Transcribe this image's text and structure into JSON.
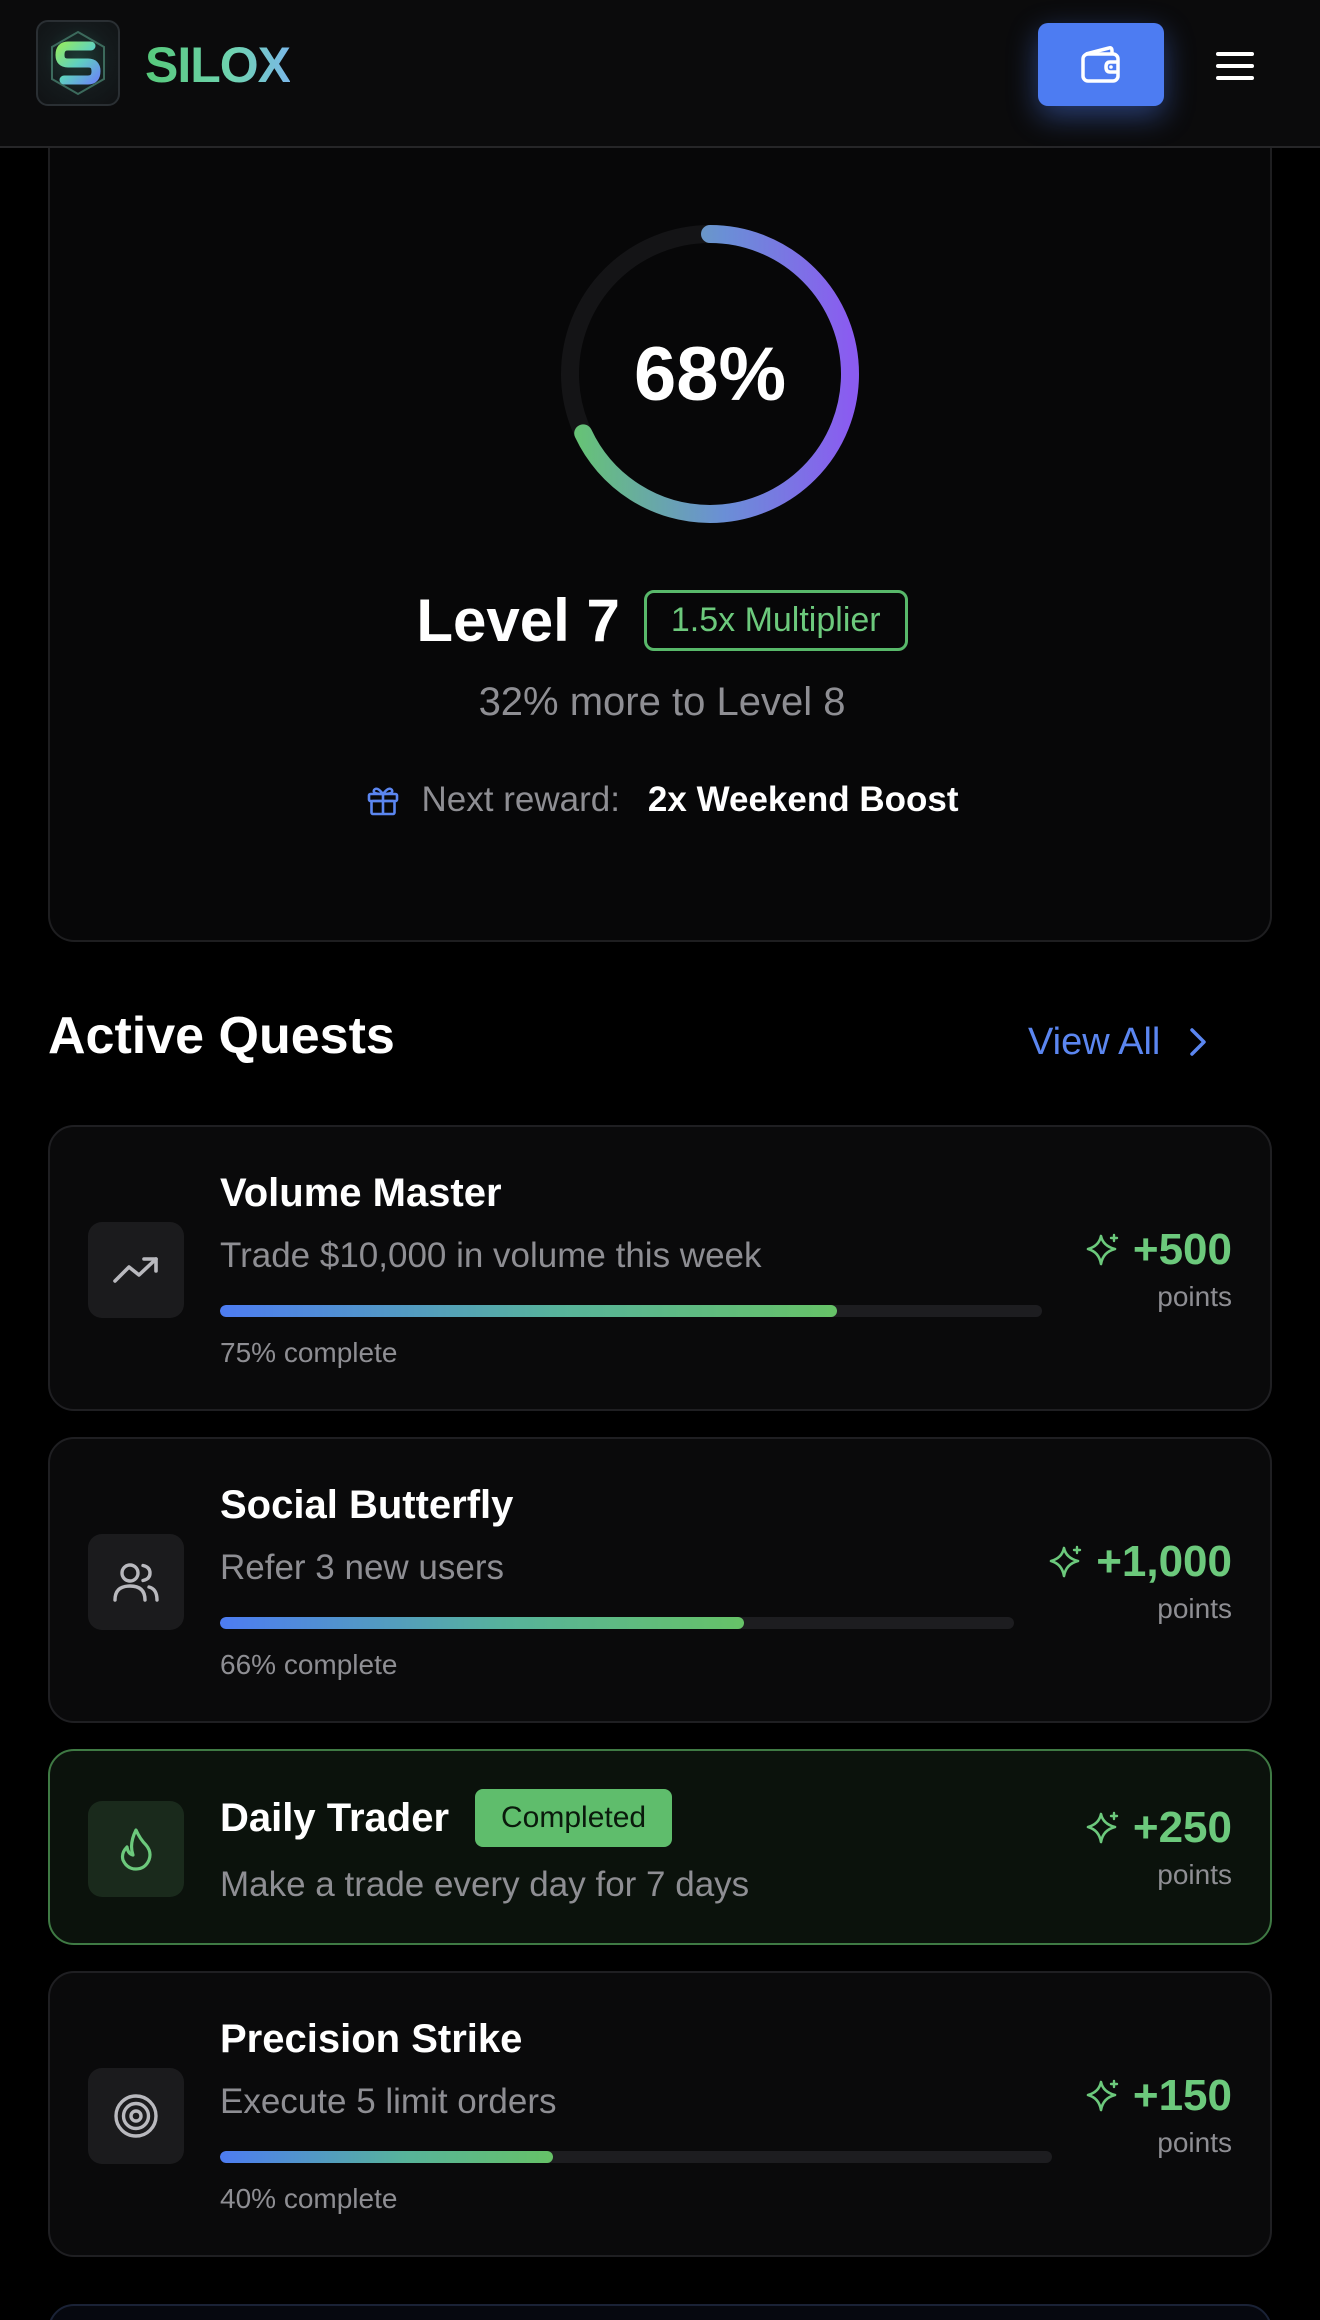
{
  "header": {
    "brand": "SILOX",
    "logo_icon": "silox-s-logo",
    "wallet_icon": "wallet-icon",
    "menu_icon": "hamburger-menu-icon"
  },
  "level_card": {
    "progress_percent_label": "68%",
    "progress_fraction": 0.68,
    "level_label": "Level 7",
    "multiplier_label": "1.5x Multiplier",
    "more_to_next": "32% more to Level 8",
    "next_reward_label": "Next reward:",
    "next_reward_value": "2x Weekend Boost",
    "reward_icon": "gift-icon"
  },
  "quests_section": {
    "title": "Active Quests",
    "view_all_label": "View All"
  },
  "quests": [
    {
      "title": "Volume Master",
      "description": "Trade $10,000 in volume this week",
      "progress": 0.75,
      "progress_label": "75% complete",
      "points": "+500",
      "points_unit": "points",
      "icon": "trending-up-icon",
      "completed": false
    },
    {
      "title": "Social Butterfly",
      "description": "Refer 3 new users",
      "progress": 0.66,
      "progress_label": "66% complete",
      "points": "+1,000",
      "points_unit": "points",
      "icon": "users-icon",
      "completed": false
    },
    {
      "title": "Daily Trader",
      "badge": "Completed",
      "description": "Make a trade every day for 7 days",
      "points": "+250",
      "points_unit": "points",
      "icon": "flame-icon",
      "completed": true
    },
    {
      "title": "Precision Strike",
      "description": "Execute 5 limit orders",
      "progress": 0.4,
      "progress_label": "40% complete",
      "points": "+150",
      "points_unit": "points",
      "icon": "target-icon",
      "completed": false
    }
  ],
  "colors": {
    "accent_blue": "#4d7cf2",
    "accent_green": "#6cc97c",
    "ring_start": "#6cc97c",
    "ring_end": "#8b5cf6"
  }
}
